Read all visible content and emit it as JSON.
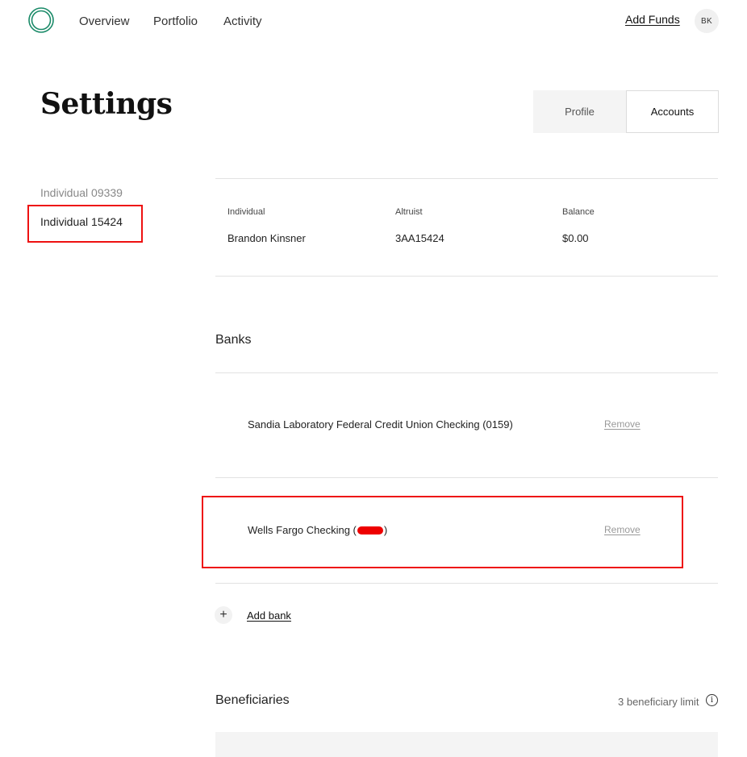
{
  "nav": {
    "links": [
      "Overview",
      "Portfolio",
      "Activity"
    ],
    "add_funds": "Add Funds",
    "avatar_initials": "BK",
    "logo_icon": "ring-logo-icon",
    "brand_color": "#1a8a68"
  },
  "page": {
    "title": "Settings"
  },
  "tabs": {
    "profile": "Profile",
    "accounts": "Accounts",
    "selected": "Accounts"
  },
  "sidebar": {
    "accounts": [
      "Individual 09339",
      "Individual 15424"
    ],
    "selected": "Individual 15424"
  },
  "account": {
    "labels": [
      "Individual",
      "Altruist",
      "Balance"
    ],
    "values": [
      "Brandon Kinsner",
      "3AA15424",
      "$0.00"
    ]
  },
  "banks": {
    "title": "Banks",
    "items": [
      {
        "name": "Sandia Laboratory Federal Credit Union Checking (0159)",
        "action": "Remove"
      },
      {
        "name_prefix": "Wells Fargo Checking (",
        "name_suffix": ")",
        "action": "Remove",
        "redacted": true
      }
    ],
    "add_label": "Add bank",
    "add_icon": "+"
  },
  "beneficiaries": {
    "title": "Beneficiaries",
    "limit": "3 beneficiary limit",
    "info_icon": "i"
  },
  "colors": {
    "highlight": "#ee1111",
    "divider": "#e2e2e2"
  }
}
